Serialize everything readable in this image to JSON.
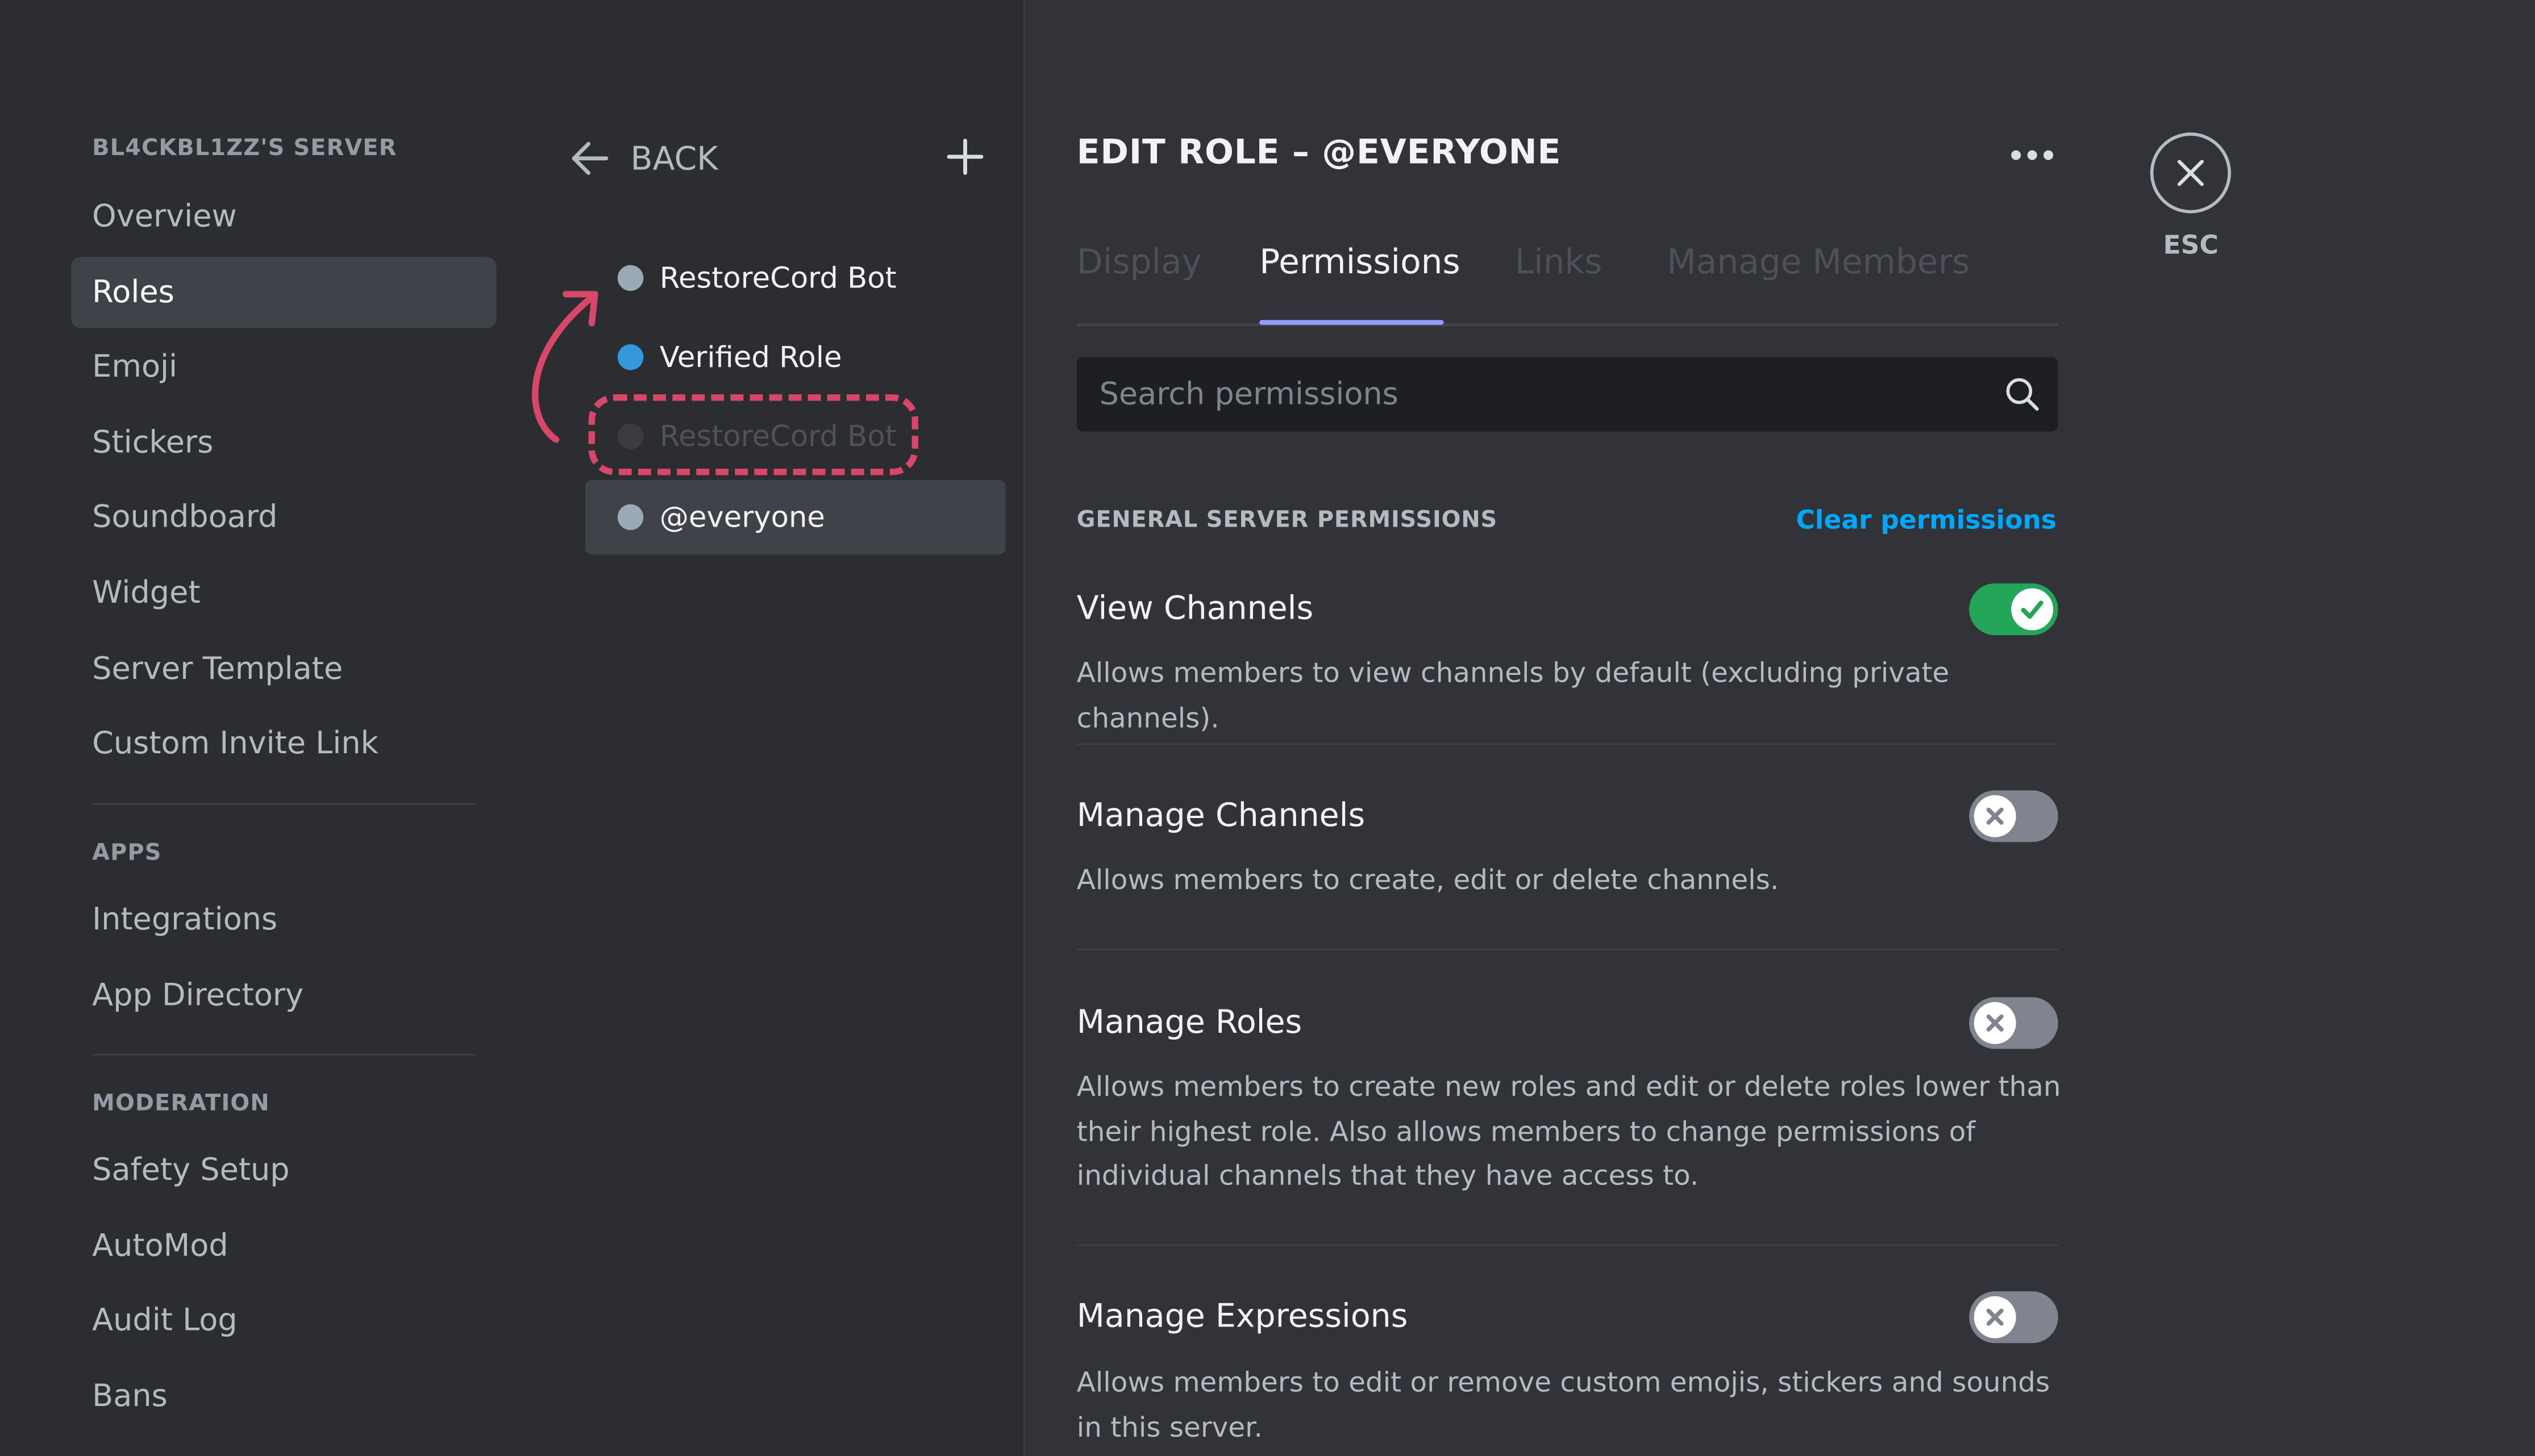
{
  "sidebar": {
    "server_title": "BL4CKBL1ZZ'S SERVER",
    "items": [
      "Overview",
      "Roles",
      "Emoji",
      "Stickers",
      "Soundboard",
      "Widget",
      "Server Template",
      "Custom Invite Link"
    ],
    "apps_title": "APPS",
    "apps_items": [
      "Integrations",
      "App Directory"
    ],
    "moderation_title": "MODERATION",
    "moderation_items": [
      "Safety Setup",
      "AutoMod",
      "Audit Log",
      "Bans"
    ],
    "active_item": "Roles"
  },
  "roles_panel": {
    "back_label": "BACK",
    "roles": [
      {
        "name": "RestoreCord Bot",
        "color": "#99aab5"
      },
      {
        "name": "Verified Role",
        "color": "#3498db"
      },
      {
        "name": "RestoreCord Bot",
        "color": "#3a3c42"
      },
      {
        "name": "@everyone",
        "color": "#99aab5"
      }
    ],
    "selected_role": "@everyone"
  },
  "editor": {
    "title": "EDIT ROLE – @EVERYONE",
    "tabs": [
      "Display",
      "Permissions",
      "Links",
      "Manage Members"
    ],
    "active_tab": "Permissions",
    "search_placeholder": "Search permissions",
    "section_title": "GENERAL SERVER PERMISSIONS",
    "clear_label": "Clear permissions",
    "permissions": [
      {
        "name": "View Channels",
        "description": "Allows members to view channels by default (excluding private channels).",
        "enabled": true
      },
      {
        "name": "Manage Channels",
        "description": "Allows members to create, edit or delete channels.",
        "enabled": false
      },
      {
        "name": "Manage Roles",
        "description": "Allows members to create new roles and edit or delete roles lower than their highest role. Also allows members to change permissions of individual channels that they have access to.",
        "enabled": false
      },
      {
        "name": "Manage Expressions",
        "description": "Allows members to edit or remove custom emojis, stickers and sounds in this server.",
        "enabled": false
      }
    ]
  },
  "close": {
    "esc_label": "ESC"
  },
  "colors": {
    "accent": "#949cf7",
    "link": "#00a8fc",
    "toggle_on": "#23a55a",
    "toggle_off": "#80848e",
    "annotation": "#d9466a"
  }
}
